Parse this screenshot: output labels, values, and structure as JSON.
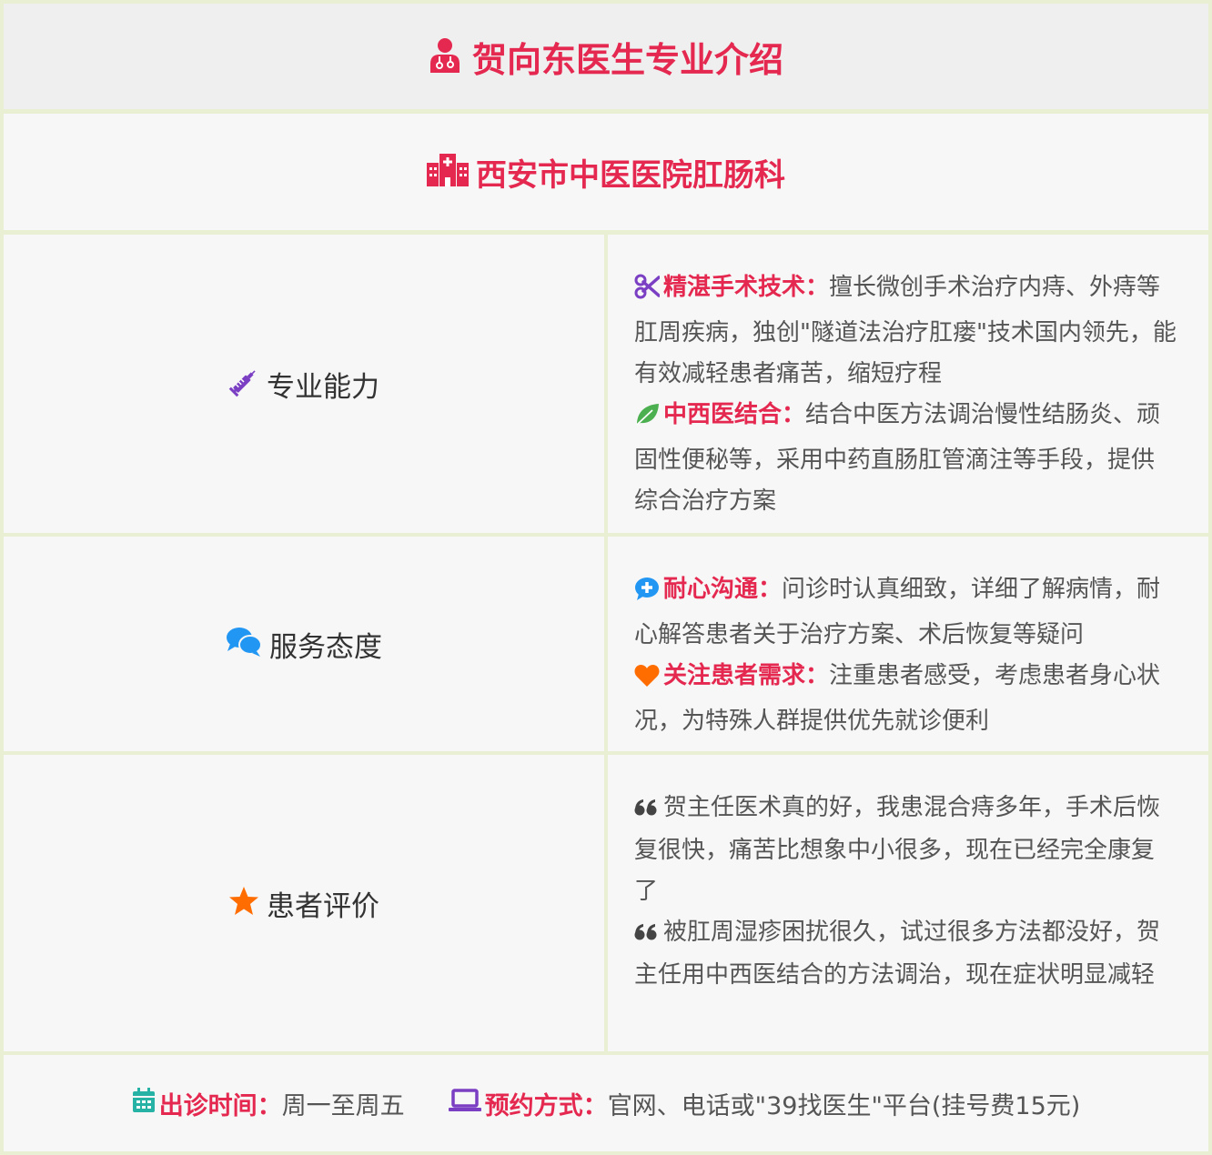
{
  "header": {
    "title": "贺向东医生专业介绍"
  },
  "department": {
    "name": "西安市中医医院肛肠科"
  },
  "sections": [
    {
      "label": "专业能力",
      "icon": "syringe-icon",
      "items": [
        {
          "icon": "scissors-icon",
          "title": "精湛手术技术：",
          "text": "擅长微创手术治疗内痔、外痔等肛周疾病，独创\"隧道法治疗肛瘘\"技术国内领先，能有效减轻患者痛苦，缩短疗程"
        },
        {
          "icon": "leaf-icon",
          "title": "中西医结合：",
          "text": "结合中医方法调治慢性结肠炎、顽固性便秘等，采用中药直肠肛管滴注等手段，提供综合治疗方案"
        }
      ]
    },
    {
      "label": "服务态度",
      "icon": "comments-icon",
      "items": [
        {
          "icon": "medical-chat-icon",
          "title": "耐心沟通：",
          "text": "问诊时认真细致，详细了解病情，耐心解答患者关于治疗方案、术后恢复等疑问"
        },
        {
          "icon": "heart-icon",
          "title": "关注患者需求：",
          "text": "注重患者感受，考虑患者身心状况，为特殊人群提供优先就诊便利"
        }
      ]
    },
    {
      "label": "患者评价",
      "icon": "star-icon",
      "reviews": [
        "贺主任医术真的好，我患混合痔多年，手术后恢复很快，痛苦比想象中小很多，现在已经完全康复了",
        "被肛周湿疹困扰很久，试过很多方法都没好，贺主任用中西医结合的方法调治，现在症状明显减轻"
      ]
    }
  ],
  "footer": {
    "schedule_label": "出诊时间：",
    "schedule_value": "周一至周五",
    "booking_label": "预约方式：",
    "booking_value": "官网、电话或\"39找医生\"平台(挂号费15元)"
  },
  "colors": {
    "accent": "#e4284f",
    "purple": "#7b3fc4",
    "green": "#4caf50",
    "blue": "#2196f3",
    "orange": "#ff6d00",
    "teal": "#26b3a6",
    "border": "#e8efd3"
  }
}
